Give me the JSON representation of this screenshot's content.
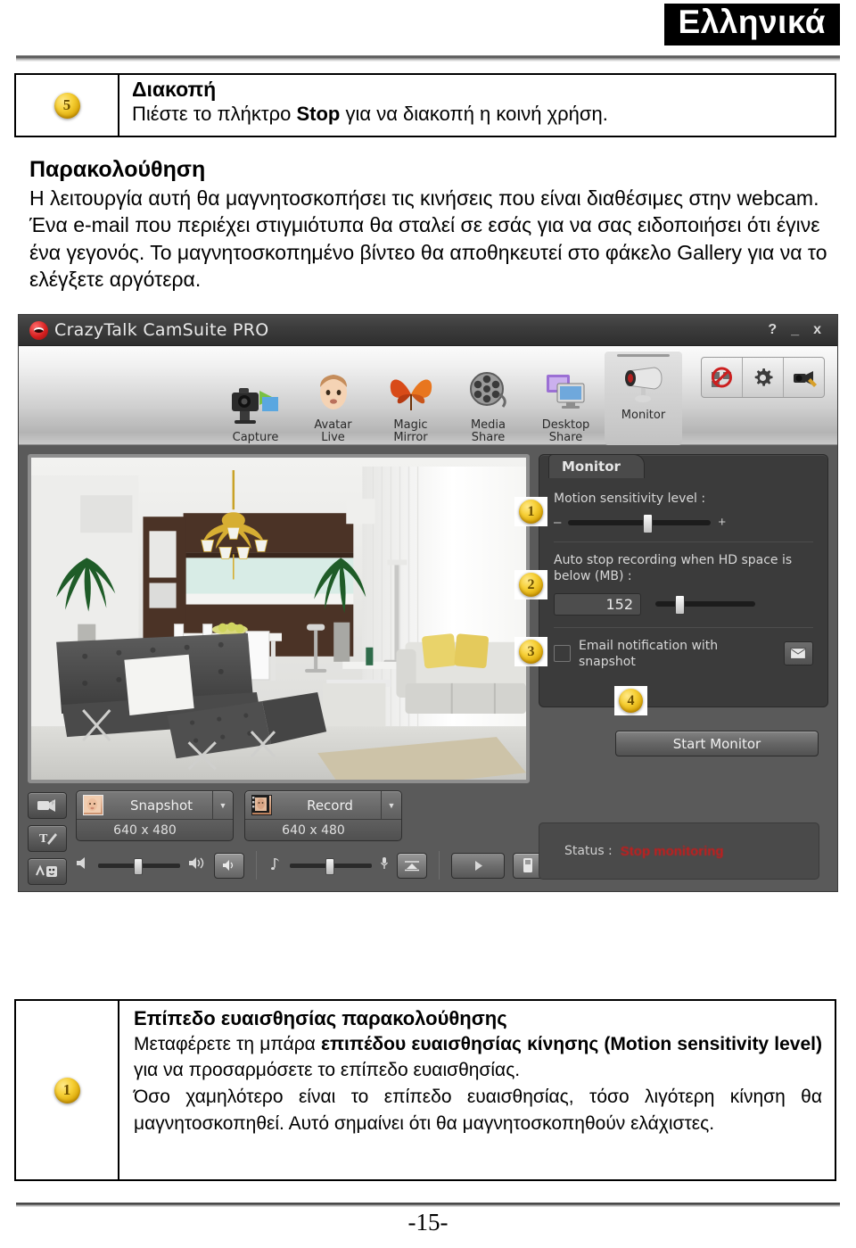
{
  "header": {
    "language_badge": "Ελληνικά"
  },
  "step_top": {
    "number": "5",
    "title": "Διακοπή",
    "text_before": "Πιέστε το πλήκτρο ",
    "text_bold": "Stop",
    "text_after": " για να διακοπή η κοινή χρήση."
  },
  "intro": {
    "heading": "Παρακολούθηση",
    "body": "Η λειτουργία αυτή θα μαγνητοσκοπήσει τις κινήσεις που είναι διαθέσιμες στην webcam. Ένα e-mail που περιέχει στιγμιότυπα θα σταλεί σε εσάς για να σας ειδοποιήσει ότι έγινε ένα γεγονός. Το μαγνητοσκοπημένο βίντεο θα αποθηκευτεί στο φάκελο Gallery για να το ελέγξετε αργότερα."
  },
  "app": {
    "title": "CrazyTalk CamSuite PRO",
    "window_buttons": {
      "help": "?",
      "minimize": "_",
      "close": "x"
    },
    "toolbar": [
      {
        "label_line1": "Capture",
        "label_line2": "",
        "icon": "camera-export-icon",
        "active": false
      },
      {
        "label_line1": "Avatar",
        "label_line2": "Live",
        "icon": "avatar-face-icon",
        "active": false
      },
      {
        "label_line1": "Magic",
        "label_line2": "Mirror",
        "icon": "butterfly-mask-icon",
        "active": false
      },
      {
        "label_line1": "Media",
        "label_line2": "Share",
        "icon": "film-reel-icon",
        "active": false
      },
      {
        "label_line1": "Desktop",
        "label_line2": "Share",
        "icon": "monitor-share-icon",
        "active": false
      },
      {
        "label_line1": "Monitor",
        "label_line2": "",
        "icon": "security-cam-icon",
        "active": true
      }
    ],
    "toolbar_right_buttons": [
      {
        "icon": "no-webcam-icon"
      },
      {
        "icon": "gear-icon"
      },
      {
        "icon": "camera-settings-icon"
      }
    ],
    "left_rail": [
      {
        "icon": "webcam-effect-icon"
      },
      {
        "icon": "text-tool-icon"
      },
      {
        "icon": "emoticon-icon"
      }
    ],
    "capture_buttons": [
      {
        "label": "Snapshot",
        "resolution": "640 x 480",
        "icon": "snapshot-thumb-icon"
      },
      {
        "label": "Record",
        "resolution": "640 x 480",
        "icon": "record-thumb-icon"
      }
    ],
    "audio": {
      "speaker_icon": "speaker-icon",
      "speaker_loud_icon": "speaker-loud-icon",
      "speaker_button_icon": "speaker-mute-icon",
      "music_icon": "music-note-icon",
      "mic_icon": "microphone-icon",
      "mic_button_icon": "mic-level-icon",
      "play_icon": "play-icon",
      "gallery_icon": "gallery-icon"
    },
    "panel": {
      "tab_label": "Monitor",
      "sensitivity_label": "Motion sensitivity level :",
      "sensitivity_minus": "–",
      "sensitivity_plus": "+",
      "autostop_label": "Auto stop recording when HD space is below (MB) :",
      "autostop_value": "152",
      "email_label": "Email notification with snapshot",
      "email_button_icon": "envelope-icon",
      "start_button": "Start Monitor"
    },
    "status": {
      "label": "Status :",
      "value": "Stop monitoring",
      "value_color": "#c91b1b"
    },
    "callouts": [
      {
        "number": "1"
      },
      {
        "number": "2"
      },
      {
        "number": "3"
      },
      {
        "number": "4"
      }
    ]
  },
  "step_bottom": {
    "number": "1",
    "title": "Επίπεδο ευαισθησίας παρακολούθησης",
    "p1_a": "Μεταφέρετε τη μπάρα ",
    "p1_bold": "επιπέδου ευαισθησίας κίνησης (Motion sensitivity level)",
    "p1_b": " για να προσαρμόσετε το επίπεδο ευαισθησίας.",
    "p2": "Όσο χαμηλότερο είναι το επίπεδο ευαισθησίας, τόσο λιγότερη κίνηση θα μαγνητοσκοπηθεί. Αυτό σημαίνει ότι θα μαγνητοσκοπηθούν ελάχιστες."
  },
  "footer": {
    "page_number": "-15-"
  }
}
